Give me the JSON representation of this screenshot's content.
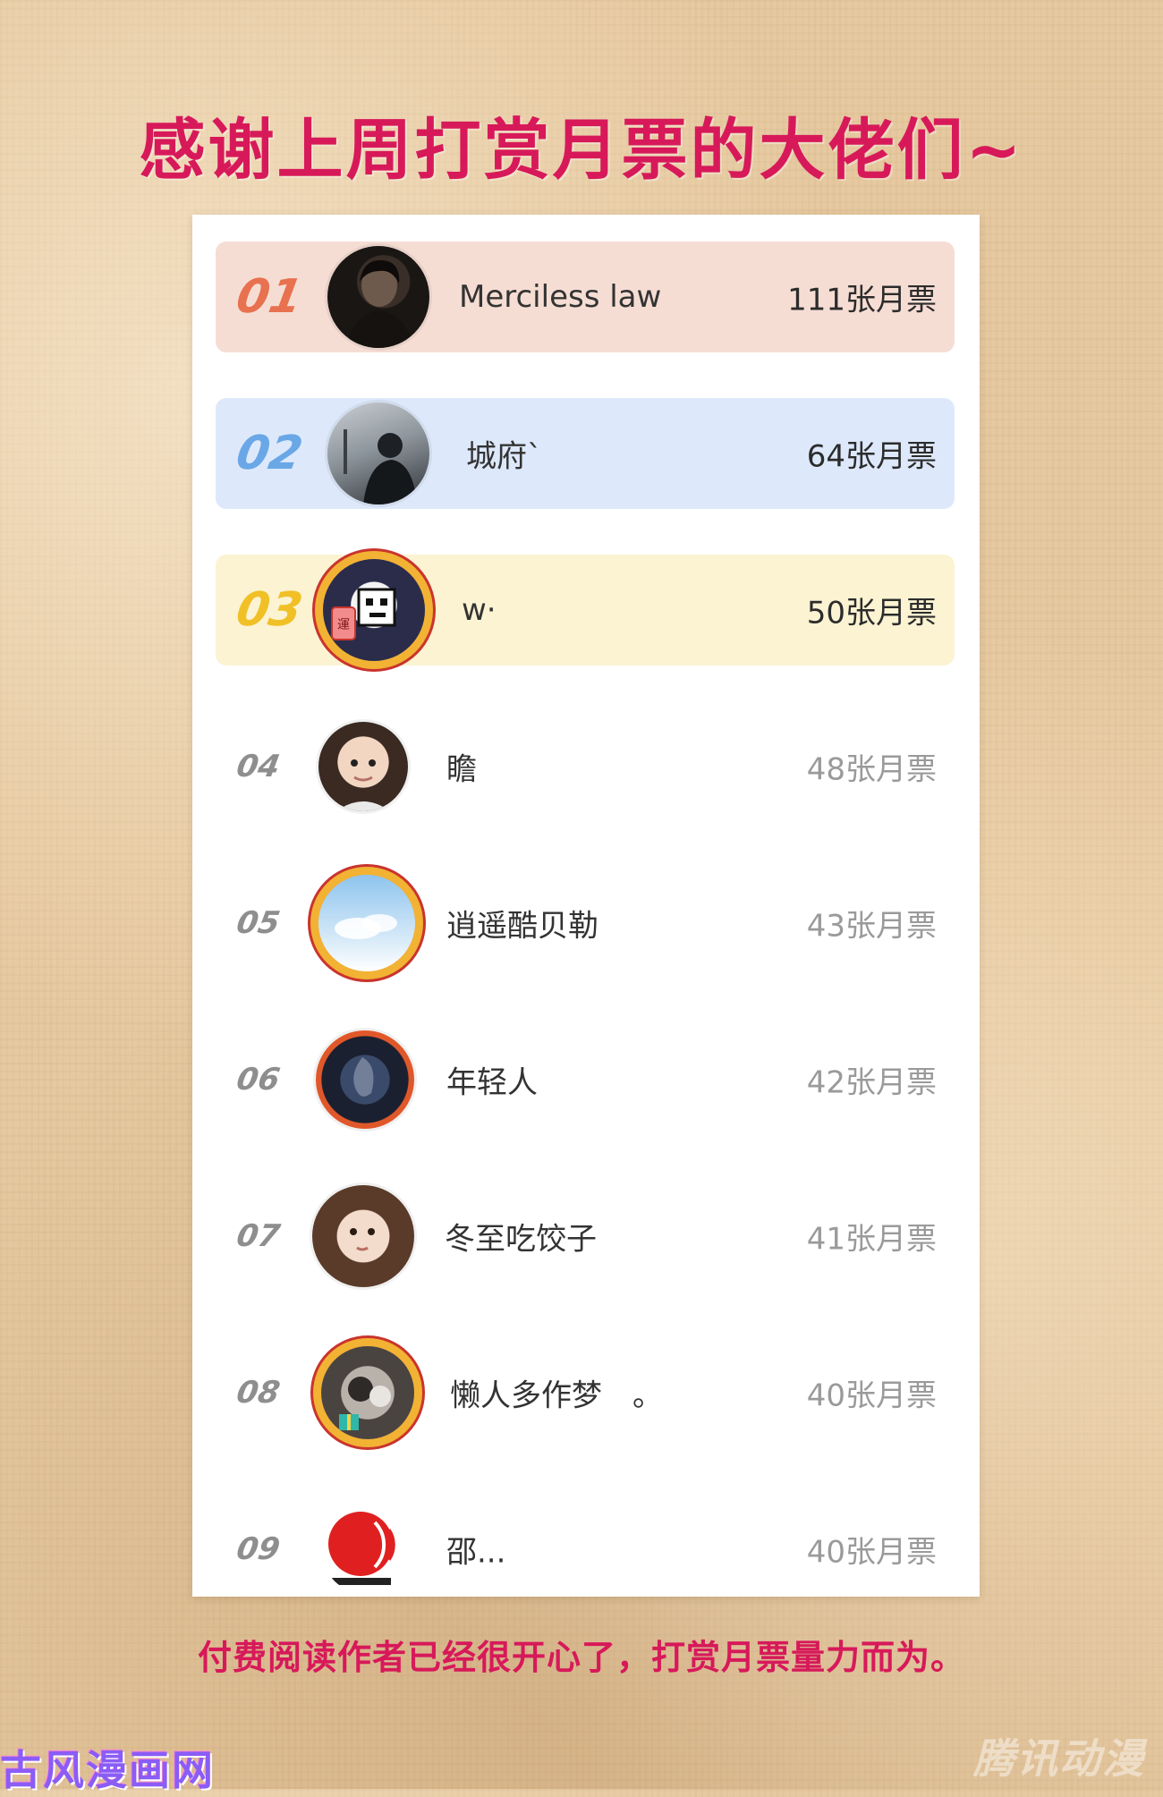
{
  "title": "感谢上周打赏月票的大佬们~",
  "entries": [
    {
      "rank": "01",
      "name": "Merciless law",
      "votes": "111张月票",
      "rank_color": "#e8714f",
      "row_bg": "#f6ddd4"
    },
    {
      "rank": "02",
      "name": "城府`",
      "votes": "64张月票",
      "rank_color": "#6aa7e6",
      "row_bg": "#dde9fb"
    },
    {
      "rank": "03",
      "name": "w·",
      "votes": "50张月票",
      "rank_color": "#f0c026",
      "row_bg": "#fbf3d2"
    },
    {
      "rank": "04",
      "name": "瞻",
      "votes": "48张月票"
    },
    {
      "rank": "05",
      "name": "逍遥酷贝勒",
      "votes": "43张月票"
    },
    {
      "rank": "06",
      "name": "年轻人",
      "votes": "42张月票"
    },
    {
      "rank": "07",
      "name": "冬至吃饺子",
      "votes": "41张月票"
    },
    {
      "rank": "08",
      "name": "懒人多作梦　。",
      "votes": "40张月票"
    },
    {
      "rank": "09",
      "name": "邵...",
      "votes": "40张月票"
    }
  ],
  "footer": "付费阅读作者已经很开心了，打赏月票量力而为。",
  "watermarks": {
    "left": "古风漫画网",
    "right": "腾讯动漫"
  },
  "colors": {
    "accent": "#d7195a"
  }
}
